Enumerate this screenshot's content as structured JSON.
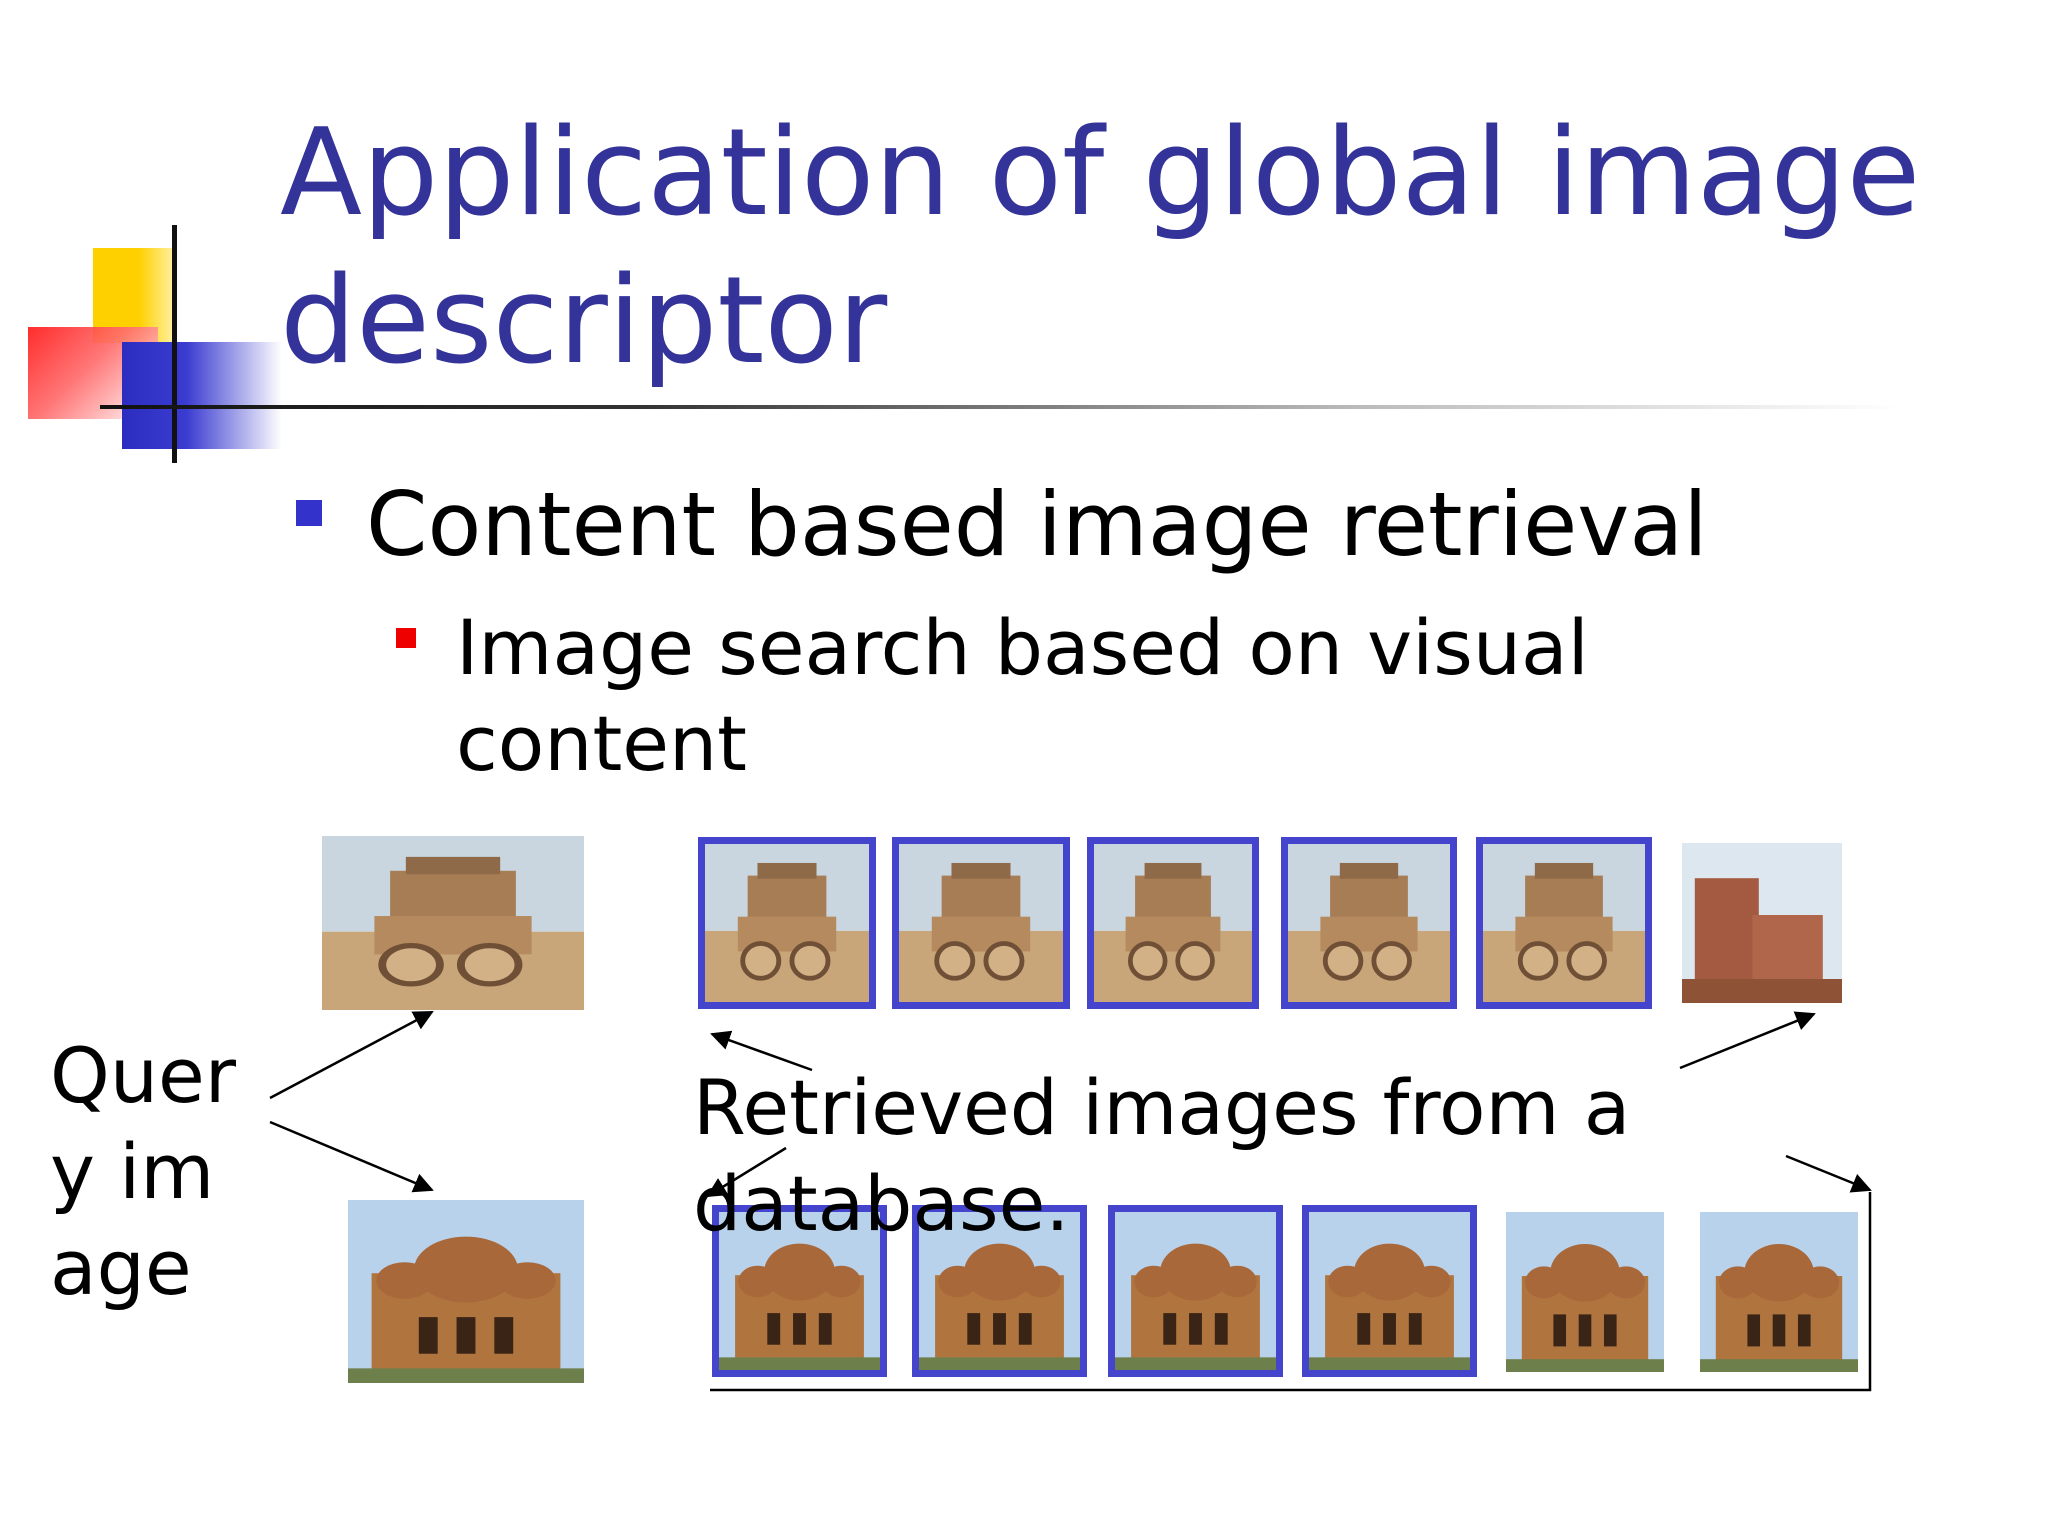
{
  "slide": {
    "title": "Application of global image descriptor",
    "bullet_level1": "Content based image retrieval",
    "bullet_level2": "Image search based on visual content"
  },
  "labels": {
    "query_image": "Query image",
    "retrieved": "Retrieved images from a database."
  },
  "colors": {
    "title": "#333399",
    "bullet1_marker": "#3333cc",
    "bullet2_marker": "#ee0000",
    "frame": "#4444cc"
  },
  "rows": [
    {
      "query": "chariot temple photo",
      "results": [
        "chariot",
        "chariot",
        "chariot",
        "chariot",
        "chariot",
        "brick ruin"
      ]
    },
    {
      "query": "terracotta temple photo",
      "results": [
        "terracotta temple",
        "terracotta temple",
        "terracotta temple",
        "terracotta temple",
        "terracotta temple",
        "terracotta temple"
      ]
    }
  ]
}
